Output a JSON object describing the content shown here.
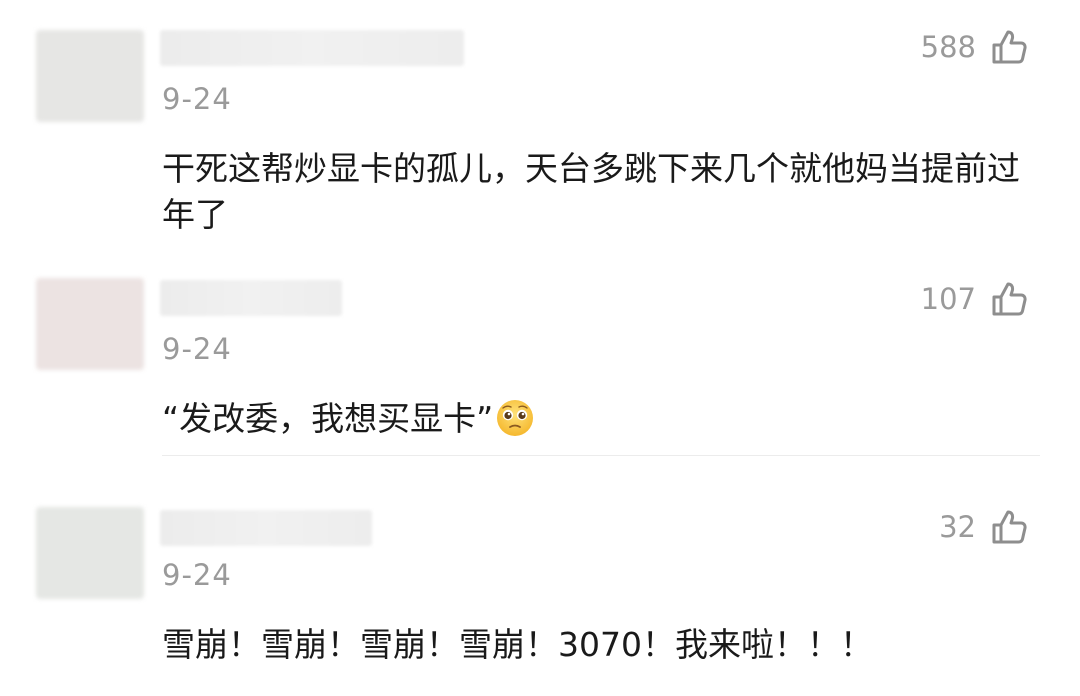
{
  "comments": [
    {
      "date": "9-24",
      "likes": "588",
      "text": "干死这帮炒显卡的孤儿，天台多跳下来几个就他妈当提前过年了",
      "avatar_color": "#e6e6e4"
    },
    {
      "date": "9-24",
      "likes": "107",
      "text": "“发改委，我想买显卡”",
      "emoji": "pleading-face-emoji",
      "avatar_color": "#ece3e2"
    },
    {
      "date": "9-24",
      "likes": "32",
      "text": "雪崩！雪崩！雪崩！雪崩！3070！我来啦！！！",
      "avatar_color": "#e5e7e4"
    }
  ],
  "icons": {
    "like": "thumbs-up-icon"
  },
  "colors": {
    "text": "#1a1a1a",
    "meta": "#9a9a9a",
    "divider": "#ececec"
  }
}
